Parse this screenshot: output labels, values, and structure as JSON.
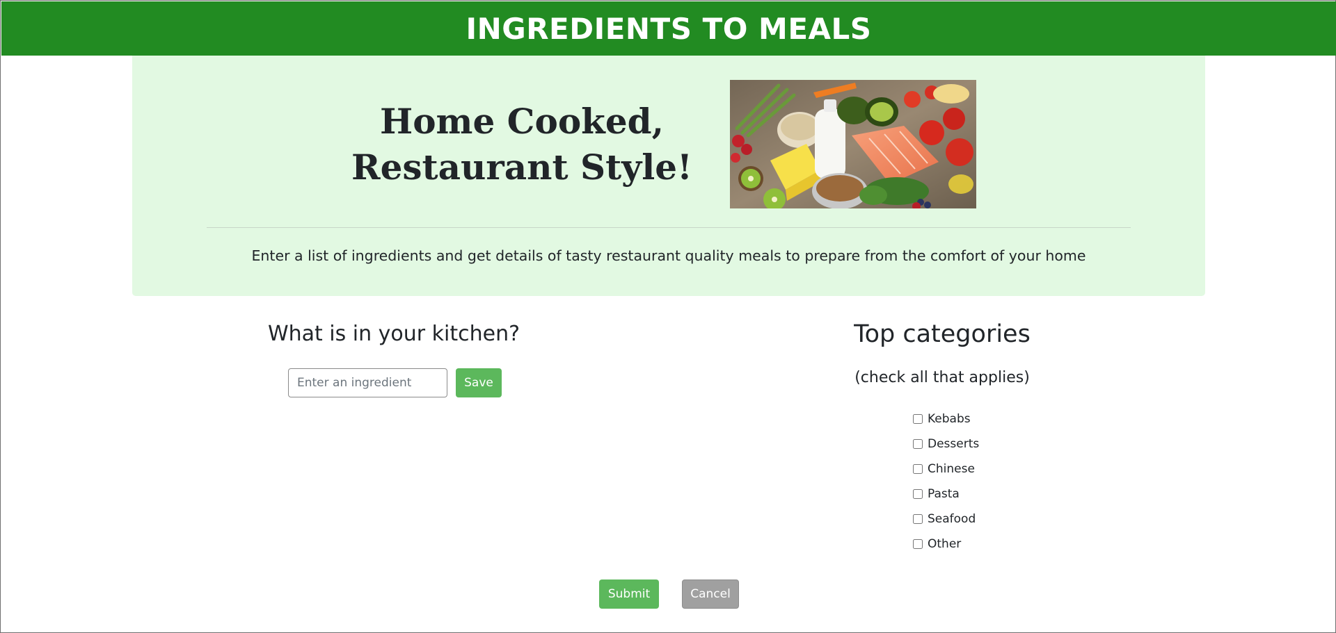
{
  "header": {
    "title": "INGREDIENTS TO MEALS",
    "background_color": "#228b22"
  },
  "hero": {
    "heading_line1": "Home Cooked,",
    "heading_line2": "Restaurant Style!",
    "image_icon": "fresh-ingredients-photo",
    "subtitle": "Enter a list of ingredients and get details of tasty restaurant quality meals to prepare from the comfort of your home",
    "background_color": "#e2f9e2"
  },
  "kitchen": {
    "title": "What is in your kitchen?",
    "input_placeholder": "Enter an ingredient",
    "input_value": "",
    "save_label": "Save"
  },
  "categories": {
    "title": "Top categories",
    "hint": "(check all that applies)",
    "items": [
      {
        "label": "Kebabs",
        "checked": false
      },
      {
        "label": "Desserts",
        "checked": false
      },
      {
        "label": "Chinese",
        "checked": false
      },
      {
        "label": "Pasta",
        "checked": false
      },
      {
        "label": "Seafood",
        "checked": false
      },
      {
        "label": "Other",
        "checked": false
      }
    ]
  },
  "actions": {
    "submit_label": "Submit",
    "cancel_label": "Cancel",
    "submit_color": "#5cb85c",
    "cancel_color": "#a0a0a0"
  }
}
